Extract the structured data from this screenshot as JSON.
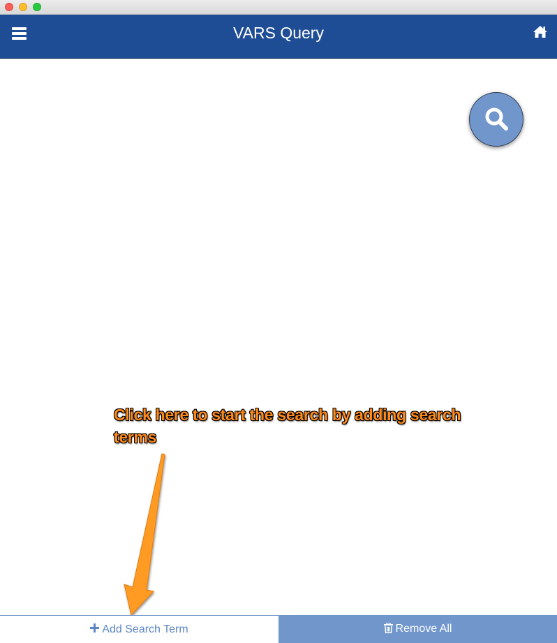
{
  "window": {
    "traffic_lights": [
      "close",
      "minimize",
      "zoom"
    ]
  },
  "header": {
    "title": "VARS Query",
    "menu_icon": "hamburger-menu-icon",
    "home_icon": "home-icon",
    "background_color": "#1e4d96"
  },
  "search_fab": {
    "icon": "search-icon",
    "color": "#7196cb"
  },
  "annotation": {
    "text": "Click here to start the search by adding search terms",
    "color": "#ff8a1a"
  },
  "bottom_bar": {
    "add_term": {
      "icon": "plus-icon",
      "label": "Add Search Term"
    },
    "remove_all": {
      "icon": "trash-icon",
      "label": "Remove All"
    },
    "accent_color": "#7196cb"
  }
}
